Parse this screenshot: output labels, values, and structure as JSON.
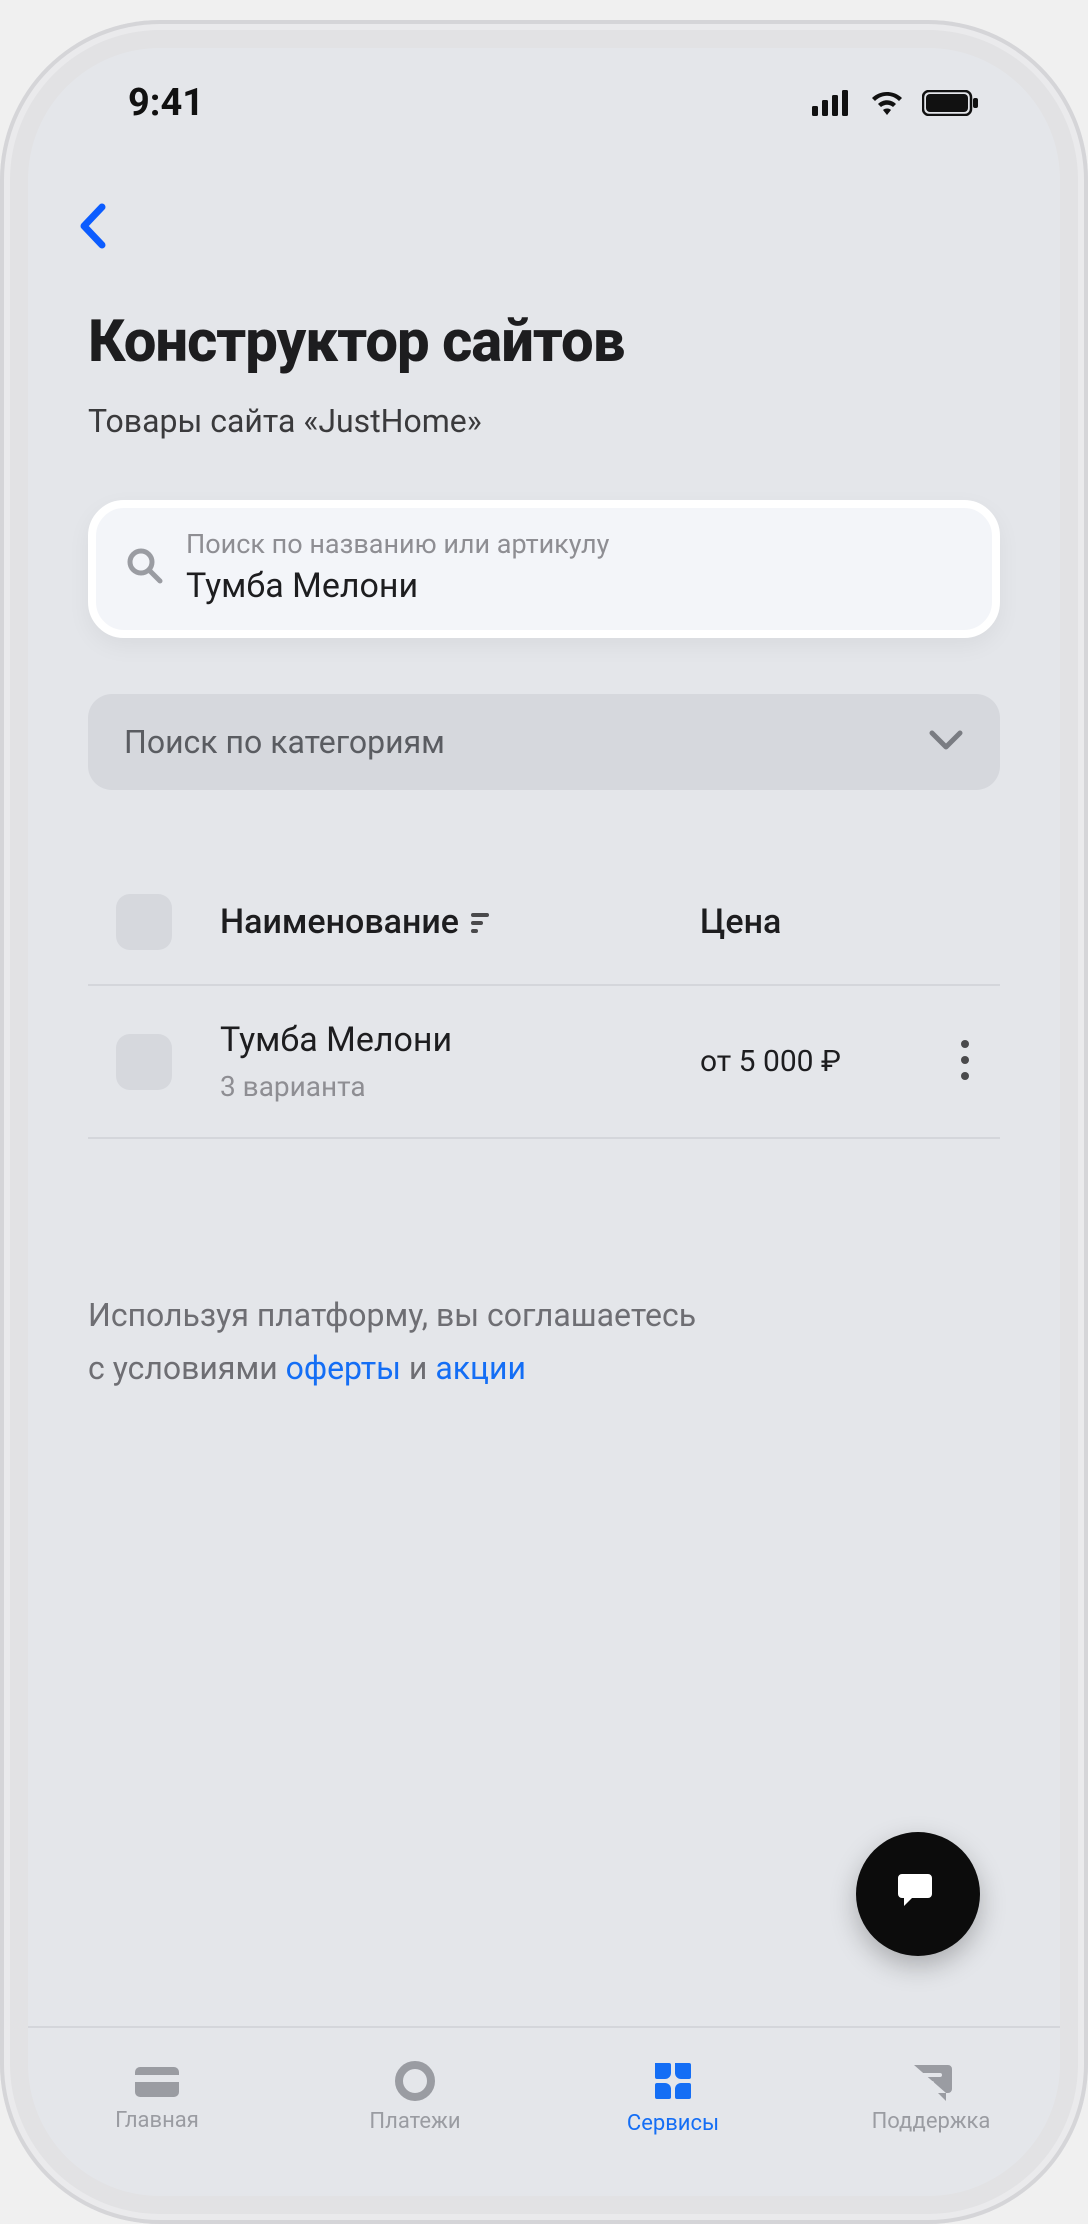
{
  "status": {
    "time": "9:41"
  },
  "header": {
    "title": "Конструктор сайтов",
    "subtitle": "Товары сайта «JustHome»"
  },
  "search": {
    "placeholder": "Поиск по названию или артикулу",
    "value": "Тумба Мелони"
  },
  "category_select": {
    "label": "Поиск по категориям"
  },
  "table": {
    "columns": {
      "name": "Наименование",
      "price": "Цена"
    },
    "rows": [
      {
        "name": "Тумба Мелони",
        "variants": "3 варианта",
        "price": "от 5 000 ₽"
      }
    ]
  },
  "legal": {
    "line1": "Используя платформу, вы соглашаетесь",
    "line2_pre": "с условиями ",
    "link1": "оферты",
    "mid": " и  ",
    "link2": "акции"
  },
  "tabs": {
    "home": "Главная",
    "payments": "Платежи",
    "services": "Сервисы",
    "support": "Поддержка"
  }
}
